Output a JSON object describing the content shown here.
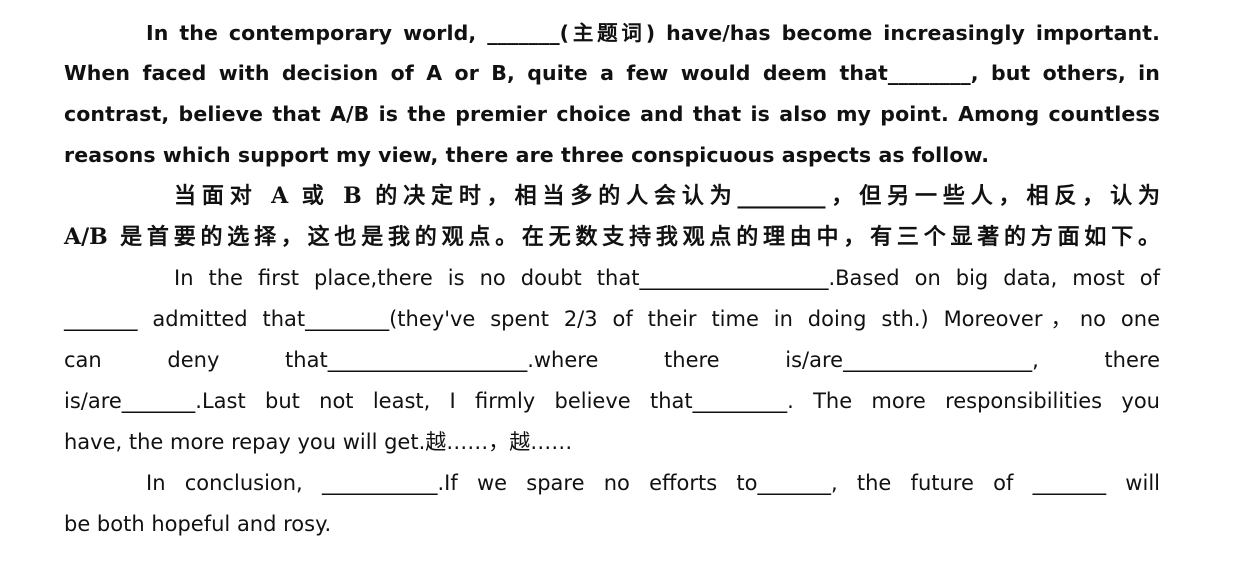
{
  "paragraph1": {
    "lines": [
      "In the contemporary world, _______(主题词) have/has become increasingly important.",
      "When faced with decision of A or B, quite a few would deem that________, but others, in",
      "contrast, believe that A/B is the premier choice and that is also my point. Among countless",
      "reasons which support my view, there are three conspicuous aspects as follow."
    ]
  },
  "paragraph2": {
    "lines": [
      "当面对 A 或 B 的决定时，相当多的人会认为________，但另一些人，相反，认为",
      "A/B 是首要的选择，这也是我的观点。在无数支持我观点的理由中，有三个显著的方面如下。"
    ]
  },
  "paragraph3": {
    "lines": [
      "In the first place,there is no doubt that__________________.Based on big data, most of",
      "_______ admitted that________(they've spent 2/3 of their time in doing sth.) Moreover，no one",
      "can deny that___________________.where there is/are__________________, there",
      "is/are_______.Last but not least, I firmly believe that_________. The more responsibilities you",
      "have, the more repay you will get.越……，越……"
    ]
  },
  "paragraph4": {
    "lines": [
      "In conclusion, ___________.If we spare no efforts to_______, the future of _______ will",
      "be both hopeful and rosy."
    ]
  }
}
